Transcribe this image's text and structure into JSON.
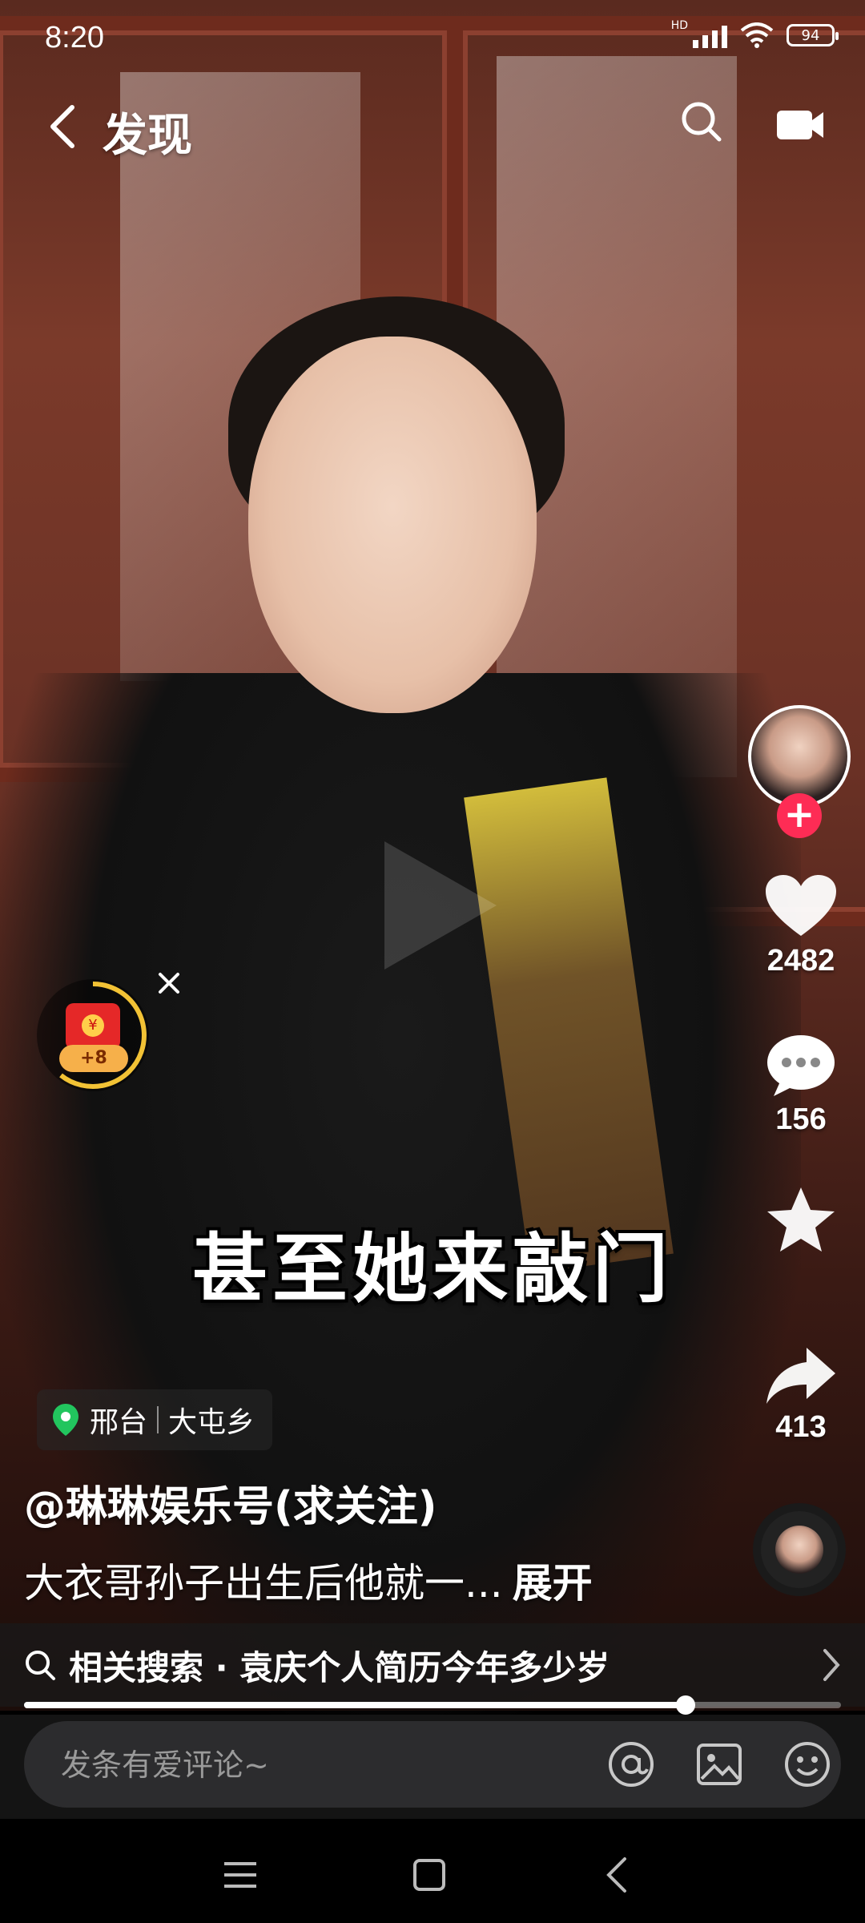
{
  "status_bar": {
    "time": "8:20",
    "network": "HD",
    "battery": "94"
  },
  "header": {
    "title": "发现"
  },
  "right_rail": {
    "likes": "2482",
    "comments": "156",
    "shares": "413"
  },
  "red_packet": {
    "badge": "+8",
    "coin_symbol": "¥"
  },
  "video": {
    "subtitle": "甚至她来敲门"
  },
  "location": {
    "city": "邢台",
    "place": "大屯乡"
  },
  "post": {
    "author": "@琳琳娱乐号(求关注)",
    "description": "大衣哥孙子出生后他就一...",
    "expand_label": "展开"
  },
  "related_search": {
    "label": "相关搜索 · 袁庆个人简历今年多少岁"
  },
  "playback": {
    "progress": 0.81
  },
  "comment_bar": {
    "placeholder": "发条有爱评论~"
  },
  "colors": {
    "accent_red": "#fe2c55",
    "comment_bg": "#2c2c2e"
  }
}
